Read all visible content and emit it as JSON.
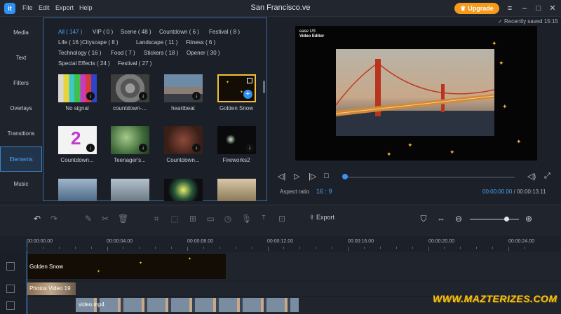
{
  "app": {
    "title": "San Francisco.ve",
    "logo": "it",
    "upgrade_label": "Upgrade"
  },
  "menu": [
    "File",
    "Edit",
    "Export",
    "Help"
  ],
  "tabs": [
    "Media",
    "Text",
    "Filters",
    "Overlays",
    "Transitions",
    "Elements",
    "Music"
  ],
  "active_tab": "Elements",
  "categories": [
    "All ( 147 )",
    "VIP ( 0 )",
    "Scene ( 48 )",
    "Countdown ( 6 )",
    "Festival ( 8 )",
    "Life ( 16 )",
    "Cityscape ( 8 )",
    "Landscape ( 11 )",
    "Fitness ( 6 )",
    "Technology ( 16 )",
    "Food ( 7 )",
    "Stickers ( 18 )",
    "Opener ( 30 )",
    "Special Effects ( 24 )",
    "Festival ( 27 )"
  ],
  "items": [
    {
      "label": "No signal"
    },
    {
      "label": "countdown-..."
    },
    {
      "label": "heartbeat"
    },
    {
      "label": "Golden Snow"
    },
    {
      "label": "Countdown..."
    },
    {
      "label": "Teenager's..."
    },
    {
      "label": "Countdown..."
    },
    {
      "label": "Fireworks2"
    },
    {
      "label": ""
    },
    {
      "label": ""
    },
    {
      "label": ""
    },
    {
      "label": ""
    }
  ],
  "preview": {
    "saved": "Recently saved 15:15",
    "watermark_line1": "ease US",
    "watermark_line2": "Video Editor",
    "aspect_label": "Aspect ratio",
    "aspect_value": "16 : 9",
    "current_time": "00:00:00.00",
    "separator": "/",
    "total_time": "00:00:13.11"
  },
  "toolbar": {
    "export_label": "Export"
  },
  "ruler": [
    "00:00:00.00",
    "00:00:04.00",
    "00:00:08.00",
    "00:00:12.00",
    "00:00:16.00",
    "00:00:20.00",
    "00:00:24.00"
  ],
  "tracks": {
    "element_clip": "Golden Snow",
    "overlay_clip": "Photos Video 19",
    "video_clip": "video.mp4"
  },
  "brand_watermark": "WWW.MAZTERIZES.COM",
  "colors": {
    "accent": "#3b92f2",
    "upgrade": "#f59a1b",
    "watermark": "#f5c21b"
  }
}
